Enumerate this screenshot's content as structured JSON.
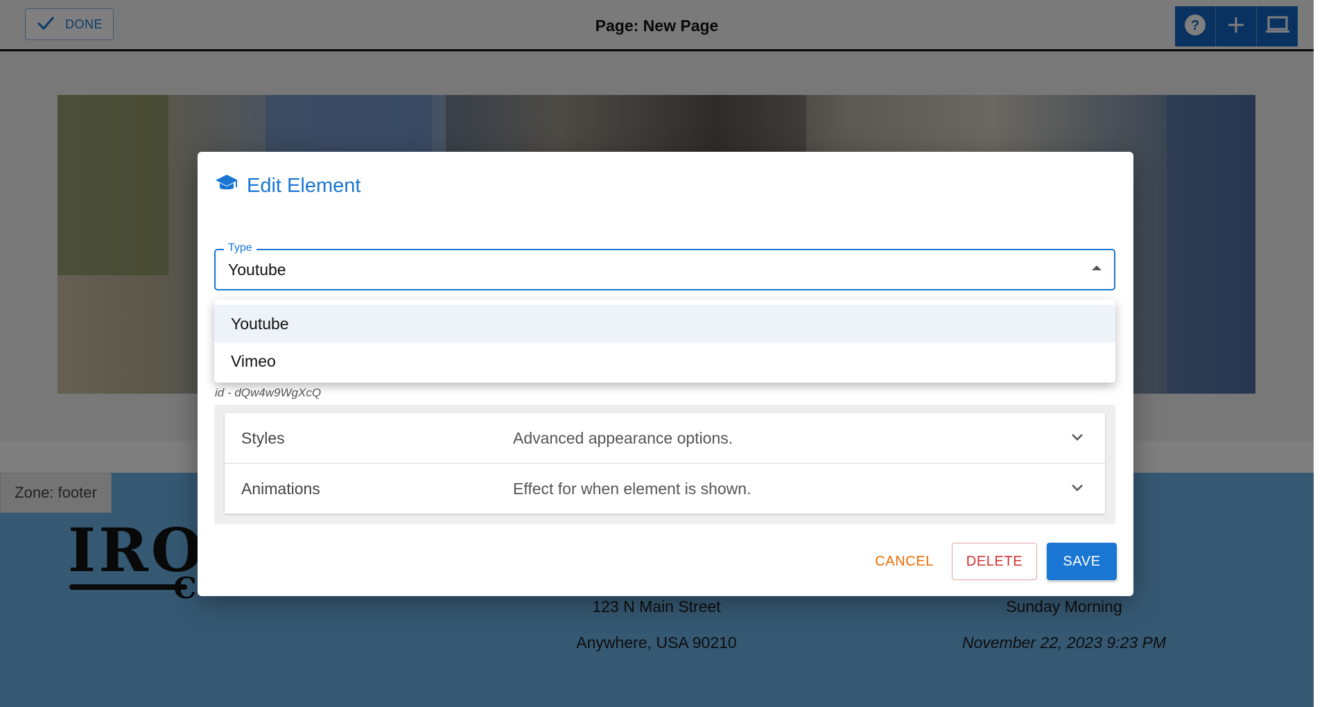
{
  "toolbar": {
    "done_label": "DONE",
    "page_title": "Page: New Page",
    "help_icon": "help-icon",
    "add_icon": "plus-icon",
    "preview_icon": "laptop-icon"
  },
  "page": {
    "zone_label": "Zone: footer",
    "logo_text": "IRO",
    "logo_sub": "C",
    "address_line1": "123 N Main Street",
    "address_line2": "Anywhere, USA 90210",
    "service_label": "Sunday Morning",
    "service_date": "November 22, 2023 9:23 PM"
  },
  "dialog": {
    "title": "Edit Element",
    "title_icon": "graduation-cap-icon",
    "type_label": "Type",
    "type_value": "Youtube",
    "options": [
      "Youtube",
      "Vimeo"
    ],
    "id_text": "id - dQw4w9WgXcQ",
    "sections": [
      {
        "name": "Styles",
        "description": "Advanced appearance options."
      },
      {
        "name": "Animations",
        "description": "Effect for when element is shown."
      }
    ],
    "cancel_label": "CANCEL",
    "delete_label": "DELETE",
    "save_label": "SAVE"
  },
  "colors": {
    "primary": "#1976d2",
    "cancel": "#ef6c00",
    "delete": "#d32f2f",
    "footer_bg": "#6cb3e6"
  }
}
